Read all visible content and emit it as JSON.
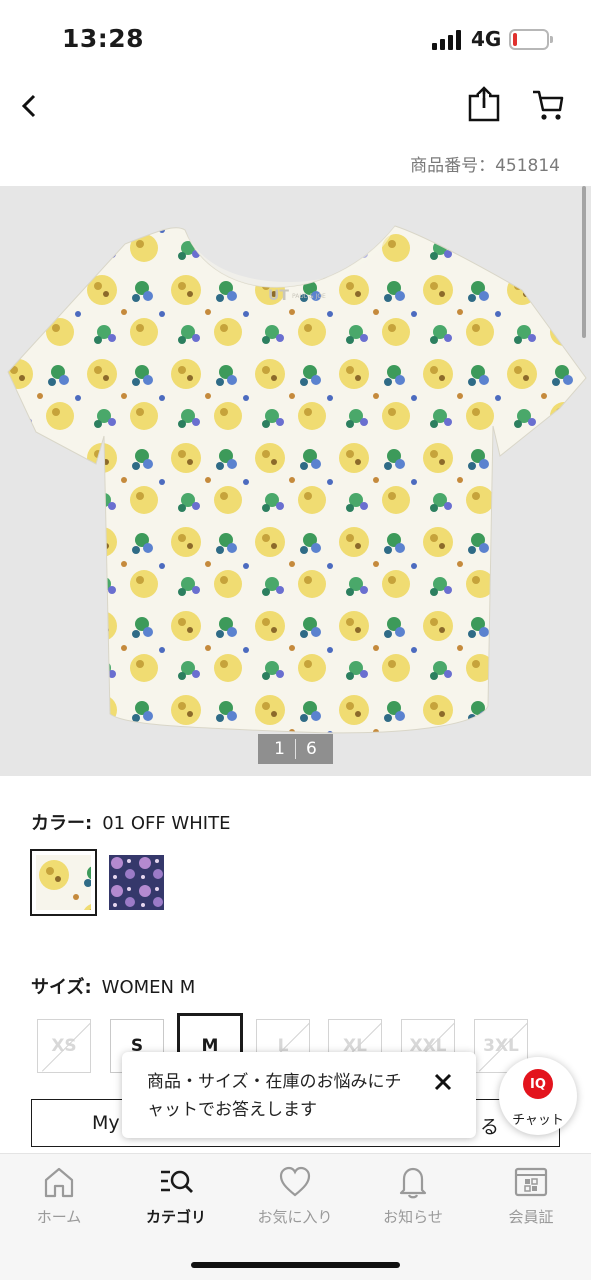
{
  "status_bar": {
    "time": "13:28",
    "network": "4G"
  },
  "product": {
    "number_label": "商品番号：451814"
  },
  "gallery": {
    "current": "1",
    "total": "6"
  },
  "color": {
    "key": "カラー:",
    "value": "01 OFF WHITE",
    "swatches": [
      "01 OFF WHITE",
      "navy floral"
    ]
  },
  "size": {
    "key": "サイズ:",
    "value": "WOMEN M",
    "options": [
      "XS",
      "S",
      "M",
      "L",
      "XL",
      "XXL",
      "3XL"
    ]
  },
  "my_size": {
    "left": "My",
    "right": "る"
  },
  "chat_tip": {
    "message": "商品・サイズ・在庫のお悩みにチャットでお答えします",
    "button_badge": "IQ",
    "button_label": "チャット"
  },
  "tabbar": {
    "items": [
      {
        "label": "ホーム",
        "icon": "home-icon"
      },
      {
        "label": "カテゴリ",
        "icon": "category-search-icon"
      },
      {
        "label": "お気に入り",
        "icon": "heart-icon"
      },
      {
        "label": "お知らせ",
        "icon": "bell-icon"
      },
      {
        "label": "会員証",
        "icon": "member-card-icon"
      }
    ]
  },
  "colors": {
    "ink": "#1b1b1b",
    "brand_red": "#e3141d",
    "gallery_bg": "#e6e6e6"
  }
}
